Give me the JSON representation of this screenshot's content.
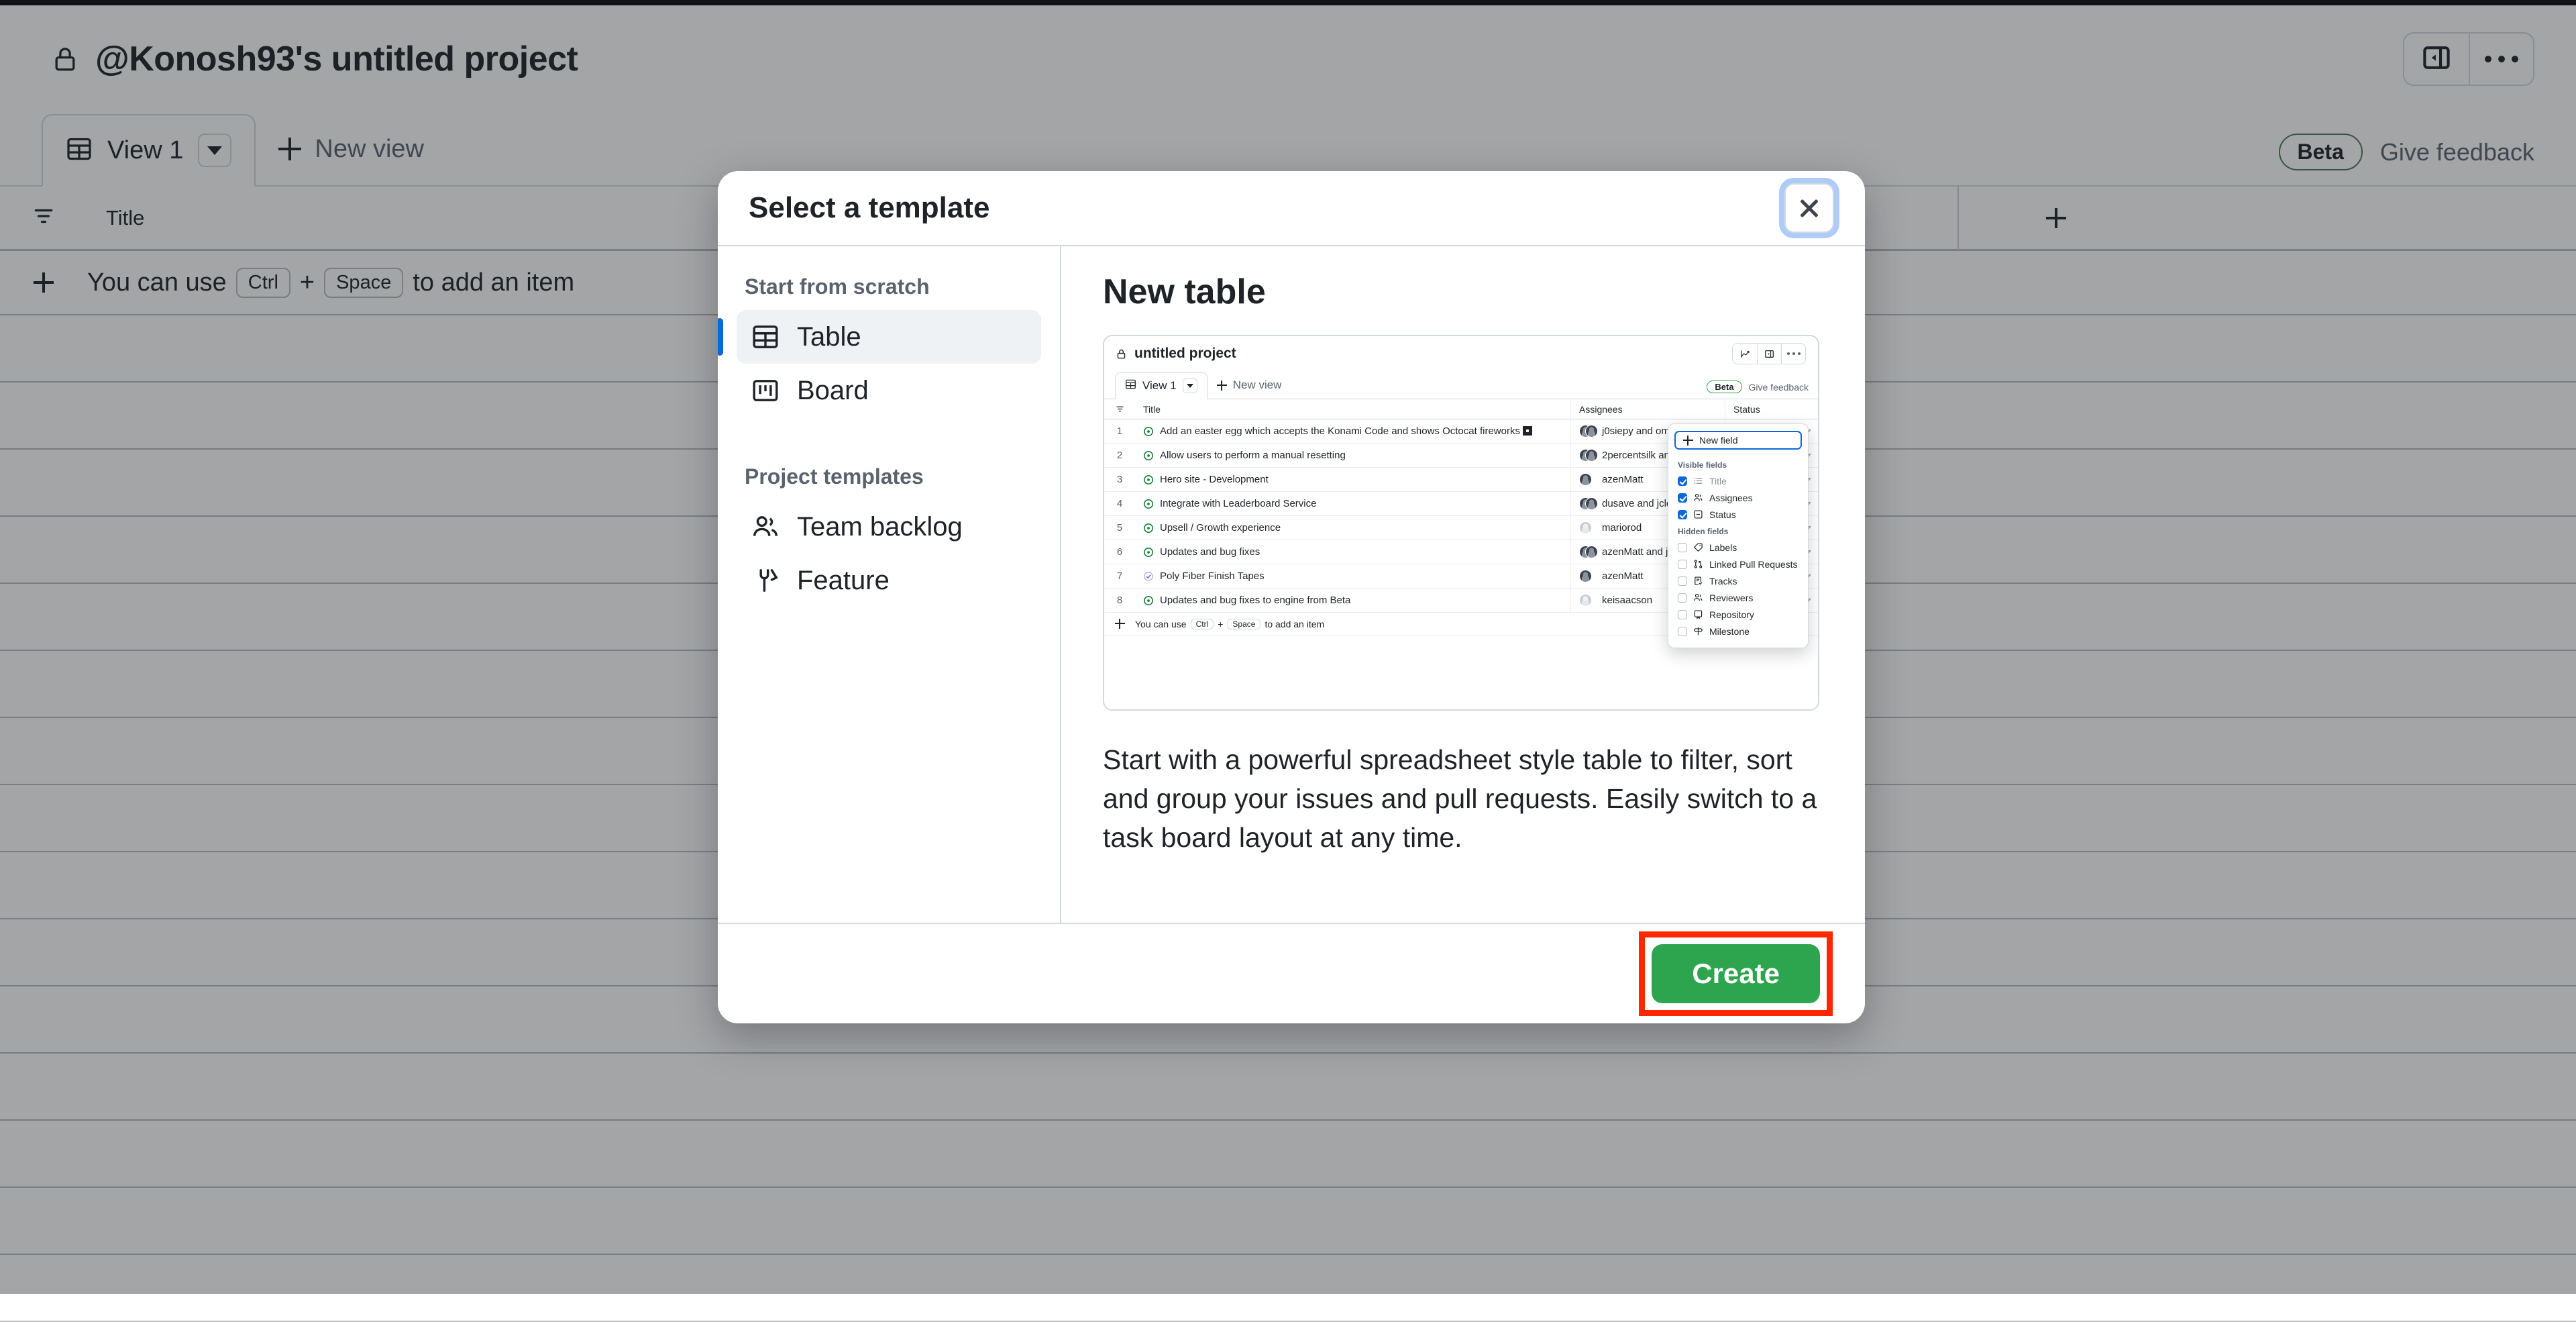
{
  "app": {
    "project_title": "@Konosh93's untitled project",
    "lock_icon": "lock-icon",
    "sidebar_toggle_icon": "sidebar-toggle-icon",
    "overflow_icon": "kebab-menu-icon",
    "view_tab": {
      "label": "View 1",
      "icon": "table-view-icon",
      "caret_icon": "chevron-down-icon"
    },
    "new_view_label": "New view",
    "beta_badge": "Beta",
    "give_feedback": "Give feedback",
    "table": {
      "filter_icon": "filter-icon",
      "title_column": "Title",
      "add_column_icon": "plus-icon",
      "hint": {
        "add_icon": "plus-icon",
        "prefix": "You can use",
        "key1": "Ctrl",
        "joiner": "+",
        "key2": "Space",
        "suffix": "to add an item"
      },
      "empty_row_count": 15
    }
  },
  "modal": {
    "title": "Select a template",
    "close_icon": "close-icon",
    "sidebar": {
      "scratch_heading": "Start from scratch",
      "scratch_items": [
        {
          "label": "Table",
          "icon": "table-icon",
          "selected": true
        },
        {
          "label": "Board",
          "icon": "board-icon",
          "selected": false
        }
      ],
      "templates_heading": "Project templates",
      "template_items": [
        {
          "label": "Team backlog",
          "icon": "people-icon"
        },
        {
          "label": "Feature",
          "icon": "tools-icon"
        }
      ]
    },
    "detail": {
      "title": "New table",
      "description": "Start with a powerful spreadsheet style table to filter, sort and group your issues and pull requests. Easily switch to a task board layout at any time."
    },
    "footer": {
      "create_label": "Create",
      "highlight_color": "#ff2600",
      "button_color": "#2da44e"
    }
  },
  "preview": {
    "project_title": "untitled project",
    "lock_icon": "lock-icon",
    "toolbar_icons": [
      "insights-chart-icon",
      "sidebar-toggle-icon",
      "kebab-menu-icon"
    ],
    "view_tab_label": "View 1",
    "new_view_label": "New view",
    "beta_badge": "Beta",
    "give_feedback": "Give feedback",
    "columns": [
      "Title",
      "Assignees",
      "Status"
    ],
    "filter_icon": "filter-icon",
    "rows": [
      {
        "num": "1",
        "title": "Add an easter egg which accepts the Konami Code and shows Octocat fireworks",
        "has_emoji": true,
        "status_icon": "issue-open-icon",
        "assignee": "j0siepy and omer",
        "avatars": 2,
        "avatar_style": "dark"
      },
      {
        "num": "2",
        "title": "Allow users to perform a manual resetting",
        "has_emoji": false,
        "status_icon": "issue-open-icon",
        "assignee": "2percentsilk and",
        "avatars": 2,
        "avatar_style": "dark"
      },
      {
        "num": "3",
        "title": "Hero site - Development",
        "has_emoji": false,
        "status_icon": "issue-open-icon",
        "assignee": "azenMatt",
        "avatars": 1,
        "avatar_style": "dark"
      },
      {
        "num": "4",
        "title": "Integrate with Leaderboard Service",
        "has_emoji": false,
        "status_icon": "issue-open-icon",
        "assignee": "dusave and jclem",
        "avatars": 2,
        "avatar_style": "dark"
      },
      {
        "num": "5",
        "title": "Upsell / Growth experience",
        "has_emoji": false,
        "status_icon": "issue-open-icon",
        "assignee": "mariorod",
        "avatars": 1,
        "avatar_style": "light"
      },
      {
        "num": "6",
        "title": "Updates and bug fixes",
        "has_emoji": false,
        "status_icon": "issue-open-icon",
        "assignee": "azenMatt and j0s",
        "avatars": 2,
        "avatar_style": "dark"
      },
      {
        "num": "7",
        "title": "Poly Fiber Finish Tapes",
        "has_emoji": false,
        "status_icon": "issue-closed-icon",
        "assignee": "azenMatt",
        "avatars": 1,
        "avatar_style": "dark"
      },
      {
        "num": "8",
        "title": "Updates and bug fixes to engine from Beta",
        "has_emoji": false,
        "status_icon": "issue-open-icon",
        "assignee": "keisaacson",
        "avatars": 1,
        "avatar_style": "light"
      }
    ],
    "hint": {
      "prefix": "You can use",
      "key1": "Ctrl",
      "joiner": "+",
      "key2": "Space",
      "suffix": "to add an item"
    },
    "field_dropdown": {
      "new_field_label": "New field",
      "new_field_icon": "plus-icon",
      "visible_heading": "Visible fields",
      "visible_fields": [
        {
          "label": "Title",
          "icon": "list-icon",
          "checked": true,
          "muted": true
        },
        {
          "label": "Assignees",
          "icon": "people-icon",
          "checked": true,
          "muted": false
        },
        {
          "label": "Status",
          "icon": "single-select-icon",
          "checked": true,
          "muted": false
        }
      ],
      "hidden_heading": "Hidden fields",
      "hidden_fields": [
        {
          "label": "Labels",
          "icon": "tag-icon",
          "checked": false,
          "muted": false
        },
        {
          "label": "Linked Pull Requests",
          "icon": "git-pull-request-icon",
          "checked": false,
          "muted": false
        },
        {
          "label": "Tracks",
          "icon": "tasklist-icon",
          "checked": false,
          "muted": false
        },
        {
          "label": "Reviewers",
          "icon": "people-icon",
          "checked": false,
          "muted": false
        },
        {
          "label": "Repository",
          "icon": "repo-icon",
          "checked": false,
          "muted": false
        },
        {
          "label": "Milestone",
          "icon": "milestone-icon",
          "checked": false,
          "muted": false
        }
      ]
    }
  }
}
